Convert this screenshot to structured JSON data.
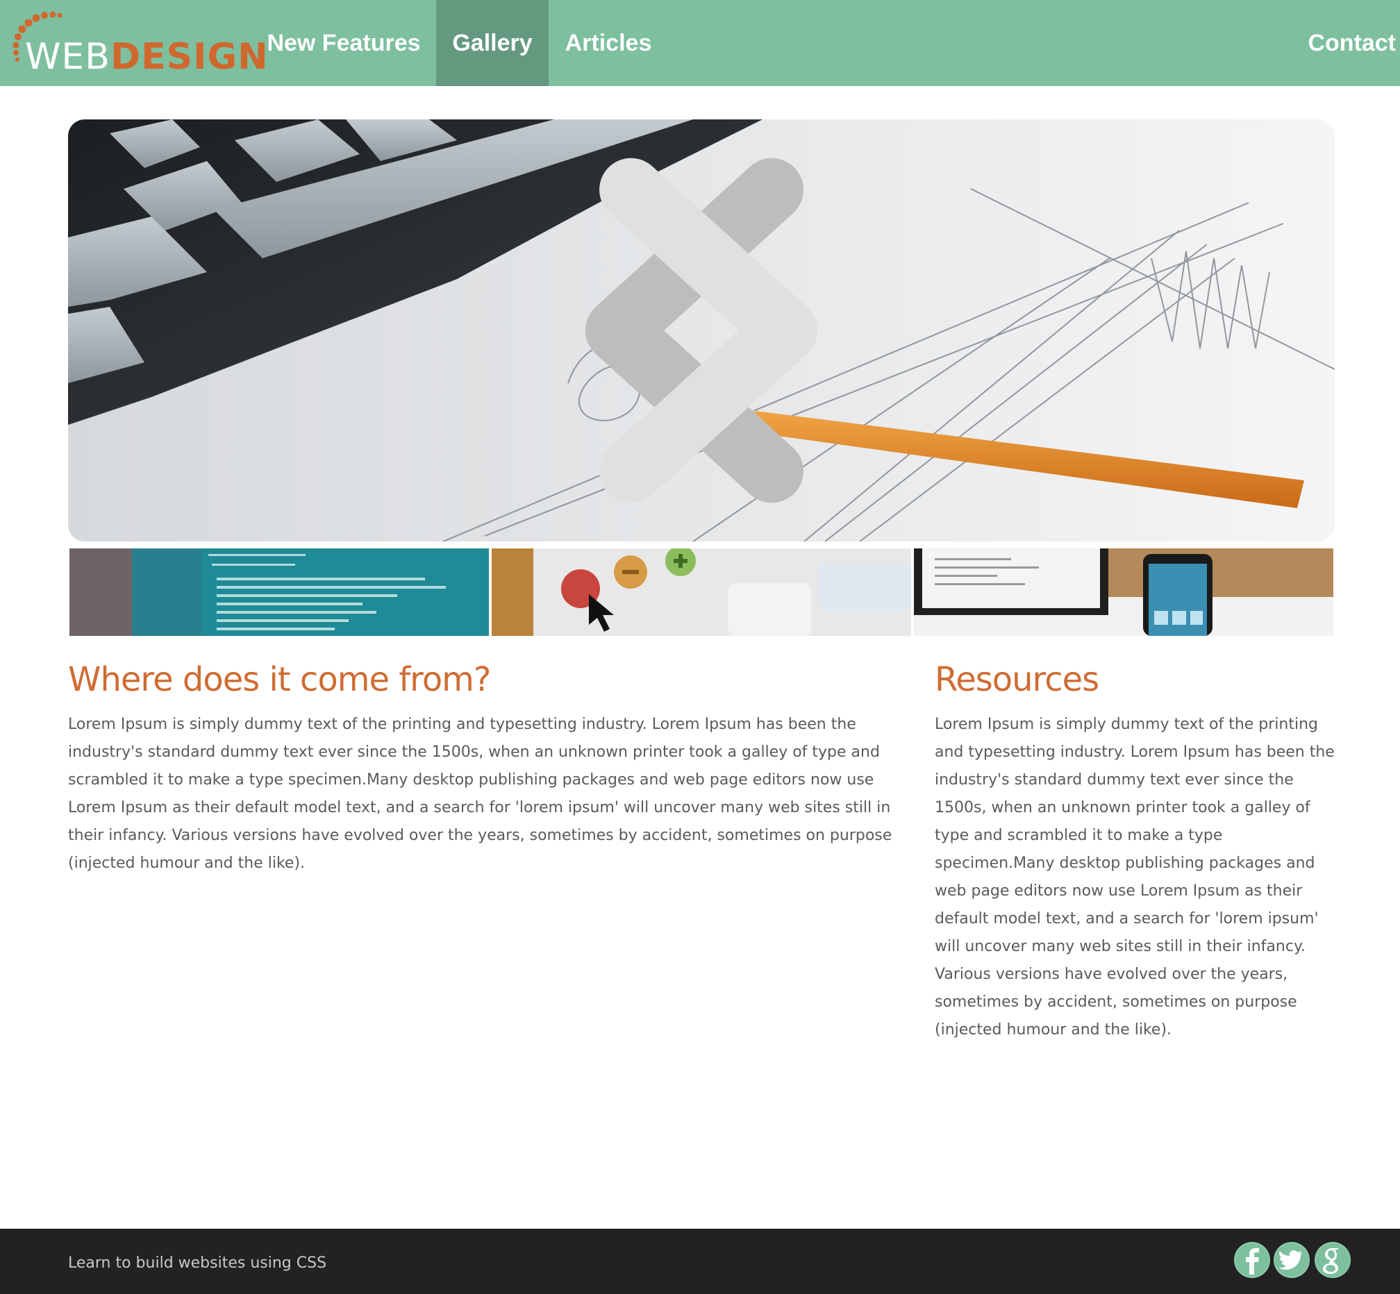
{
  "brand": {
    "logo_web": "WEB",
    "logo_design": "DESIGN",
    "accent": "#d0682e",
    "header_bg": "#7dbf9f",
    "active_nav_bg": "#65997f"
  },
  "nav": {
    "items": [
      {
        "label": "New Features"
      },
      {
        "label": "Gallery",
        "active": true
      },
      {
        "label": "Articles"
      }
    ],
    "contact": "Contact"
  },
  "slider": {
    "prev_icon": "chevron-left-icon",
    "next_icon": "chevron-right-icon",
    "thumbnails": [
      {
        "name": "code-thumbnail"
      },
      {
        "name": "window-buttons-thumbnail"
      },
      {
        "name": "devices-thumbnail"
      }
    ]
  },
  "main": {
    "title": "Where does it come from?",
    "text": "Lorem Ipsum is simply dummy text of the printing and typesetting industry. Lorem Ipsum has been the industry's standard dummy text ever since the 1500s, when an unknown printer took a galley of type and scrambled it to make a type specimen.Many desktop publishing packages and web page editors now use Lorem Ipsum as their default model text, and a search for 'lorem ipsum' will uncover many web sites still in their infancy. Various versions have evolved over the years, sometimes by accident, sometimes on purpose (injected humour and the like)."
  },
  "sidebar": {
    "title": "Resources",
    "text": "Lorem Ipsum is simply dummy text of the printing and typesetting industry. Lorem Ipsum has been the industry's standard dummy text ever since the 1500s, when an unknown printer took a galley of type and scrambled it to make a type specimen.Many desktop publishing packages and web page editors now use Lorem Ipsum as their default model text, and a search for 'lorem ipsum' will uncover many web sites still in their infancy. Various versions have evolved over the years, sometimes by accident, sometimes on purpose (injected humour and the like)."
  },
  "footer": {
    "text": "Learn to build websites using CSS",
    "social": [
      "facebook-icon",
      "twitter-icon",
      "google-plus-icon"
    ]
  }
}
